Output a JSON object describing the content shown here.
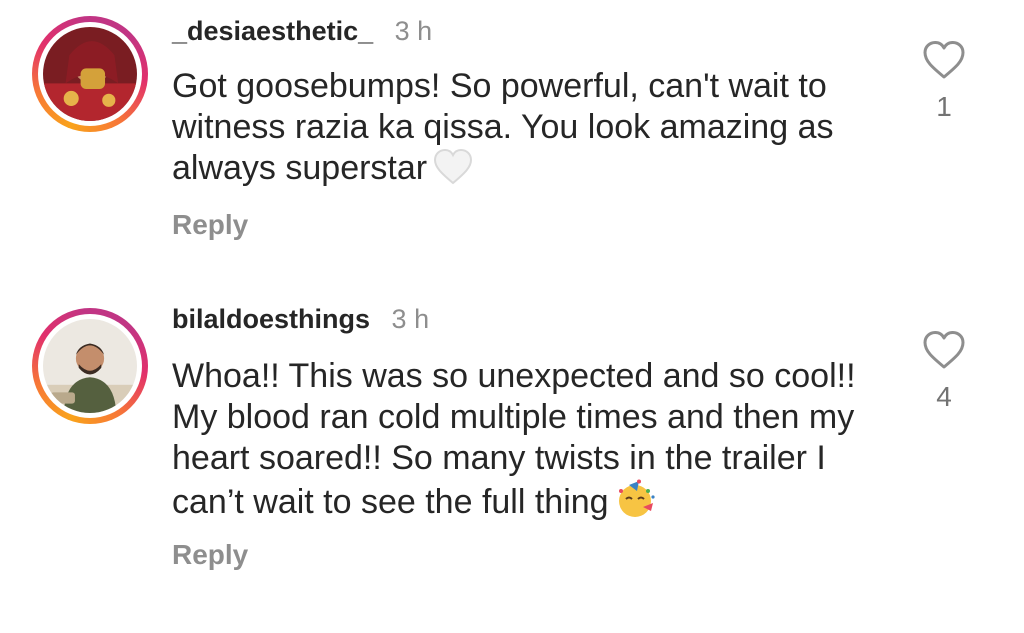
{
  "comments": [
    {
      "username": "_desiaesthetic_",
      "time": "3 h",
      "text": "Got goosebumps! So powerful, can't wait to witness razia ka qissa. You look amazing as always superstar",
      "emoji_icon": "white-heart-icon",
      "reply_label": "Reply",
      "likes": "1"
    },
    {
      "username": "bilaldoesthings",
      "time": "3 h",
      "text": "Whoa!! This was so unexpected and so cool!! My blood ran cold multiple times and then my heart soared!! So many twists in the trailer I can’t wait to see the full thing",
      "emoji_icon": "partying-face-icon",
      "reply_label": "Reply",
      "likes": "4"
    }
  ],
  "colors": {
    "text": "#262626",
    "muted": "#8e8e8e",
    "story_ring_start": "#f9a31b",
    "story_ring_end": "#c13584"
  }
}
